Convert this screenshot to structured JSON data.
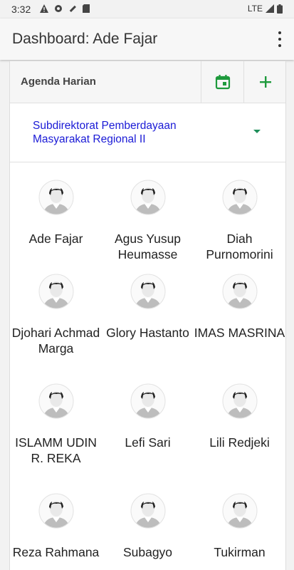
{
  "status": {
    "time": "3:32",
    "network": "LTE"
  },
  "appbar": {
    "title": "Dashboard: Ade Fajar"
  },
  "agenda": {
    "label": "Agenda Harian"
  },
  "subdir": {
    "selected": "Subdirektorat Pemberdayaan Masyarakat Regional II"
  },
  "people": [
    "Ade Fajar",
    "Agus Yusup Heumasse",
    "Diah Purnomorini",
    "Djohari Achmad Marga",
    "Glory Hastanto",
    "IMAS MASRINA",
    "ISLAMM UDIN R. REKA",
    "Lefi Sari",
    "Lili Redjeki",
    "Reza Rahmana",
    "Subagyo",
    "Tukirman"
  ],
  "colors": {
    "accent_green": "#1e9a3c",
    "link_blue": "#1a1ad6"
  }
}
